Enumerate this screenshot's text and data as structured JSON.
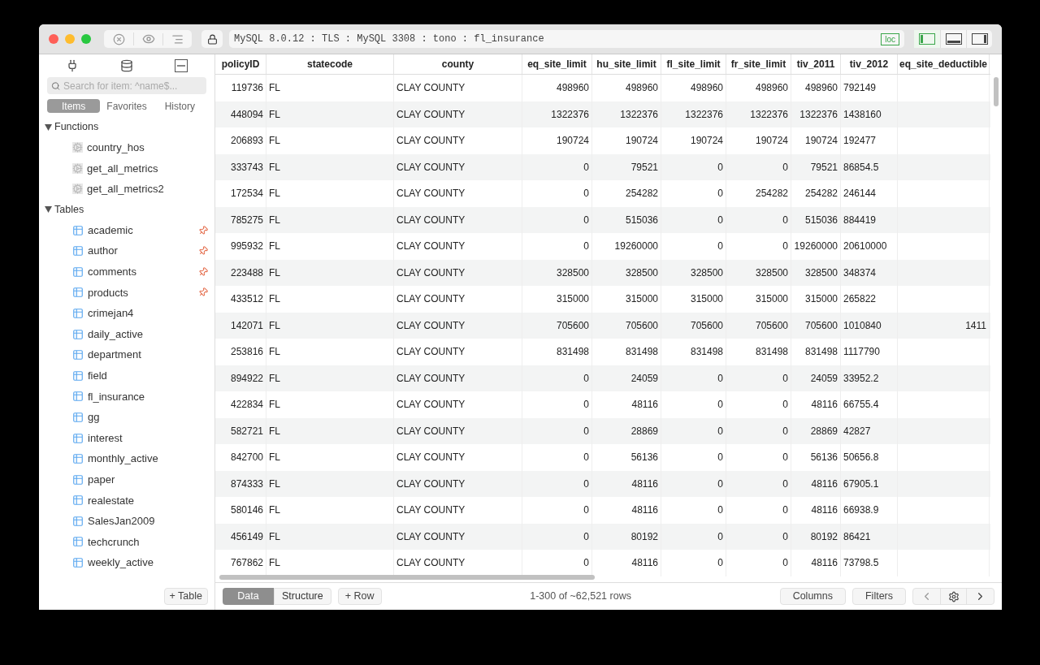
{
  "toolbar": {
    "connection": "MySQL 8.0.12 : TLS : MySQL 3308 : tono : fl_insurance",
    "badge": "loc",
    "layouts": [
      {
        "selected": true
      },
      {
        "selected": false
      },
      {
        "selected": false
      }
    ]
  },
  "sidebar": {
    "search": {
      "placeholder": "Search for item: ^name$..."
    },
    "tabs": [
      {
        "label": "Items",
        "selected": true
      },
      {
        "label": "Favorites",
        "selected": false
      },
      {
        "label": "History",
        "selected": false
      }
    ],
    "groups": [
      {
        "label": "Functions",
        "expanded": true,
        "kind": "function",
        "children": [
          {
            "label": "country_hos",
            "pinned": false
          },
          {
            "label": "get_all_metrics",
            "pinned": false
          },
          {
            "label": "get_all_metrics2",
            "pinned": false
          }
        ]
      },
      {
        "label": "Tables",
        "expanded": true,
        "kind": "table",
        "children": [
          {
            "label": "academic",
            "pinned": true
          },
          {
            "label": "author",
            "pinned": true
          },
          {
            "label": "comments",
            "pinned": true
          },
          {
            "label": "products",
            "pinned": true
          },
          {
            "label": "crimejan4",
            "pinned": false
          },
          {
            "label": "daily_active",
            "pinned": false
          },
          {
            "label": "department",
            "pinned": false
          },
          {
            "label": "field",
            "pinned": false
          },
          {
            "label": "fl_insurance",
            "pinned": false
          },
          {
            "label": "gg",
            "pinned": false
          },
          {
            "label": "interest",
            "pinned": false
          },
          {
            "label": "monthly_active",
            "pinned": false
          },
          {
            "label": "paper",
            "pinned": false
          },
          {
            "label": "realestate",
            "pinned": false
          },
          {
            "label": "SalesJan2009",
            "pinned": false
          },
          {
            "label": "techcrunch",
            "pinned": false
          },
          {
            "label": "weekly_active",
            "pinned": false
          }
        ]
      }
    ],
    "add_button": "+ Table"
  },
  "table": {
    "columns": [
      "policyID",
      "statecode",
      "county",
      "eq_site_limit",
      "hu_site_limit",
      "fl_site_limit",
      "fr_site_limit",
      "tiv_2011",
      "tiv_2012",
      "eq_site_deductible"
    ],
    "rows": [
      [
        "119736",
        "FL",
        "CLAY COUNTY",
        "498960",
        "498960",
        "498960",
        "498960",
        "498960",
        "792149"
      ],
      [
        "448094",
        "FL",
        "CLAY COUNTY",
        "1322376",
        "1322376",
        "1322376",
        "1322376",
        "1322376",
        "1438160"
      ],
      [
        "206893",
        "FL",
        "CLAY COUNTY",
        "190724",
        "190724",
        "190724",
        "190724",
        "190724",
        "192477"
      ],
      [
        "333743",
        "FL",
        "CLAY COUNTY",
        "0",
        "79521",
        "0",
        "0",
        "79521",
        "86854.5"
      ],
      [
        "172534",
        "FL",
        "CLAY COUNTY",
        "0",
        "254282",
        "0",
        "254282",
        "254282",
        "246144"
      ],
      [
        "785275",
        "FL",
        "CLAY COUNTY",
        "0",
        "515036",
        "0",
        "0",
        "515036",
        "884419"
      ],
      [
        "995932",
        "FL",
        "CLAY COUNTY",
        "0",
        "19260000",
        "0",
        "0",
        "19260000",
        "20610000"
      ],
      [
        "223488",
        "FL",
        "CLAY COUNTY",
        "328500",
        "328500",
        "328500",
        "328500",
        "328500",
        "348374"
      ],
      [
        "433512",
        "FL",
        "CLAY COUNTY",
        "315000",
        "315000",
        "315000",
        "315000",
        "315000",
        "265822"
      ],
      [
        "142071",
        "FL",
        "CLAY COUNTY",
        "705600",
        "705600",
        "705600",
        "705600",
        "705600",
        "1010840",
        "1411"
      ],
      [
        "253816",
        "FL",
        "CLAY COUNTY",
        "831498",
        "831498",
        "831498",
        "831498",
        "831498",
        "1117790"
      ],
      [
        "894922",
        "FL",
        "CLAY COUNTY",
        "0",
        "24059",
        "0",
        "0",
        "24059",
        "33952.2"
      ],
      [
        "422834",
        "FL",
        "CLAY COUNTY",
        "0",
        "48116",
        "0",
        "0",
        "48116",
        "66755.4"
      ],
      [
        "582721",
        "FL",
        "CLAY COUNTY",
        "0",
        "28869",
        "0",
        "0",
        "28869",
        "42827"
      ],
      [
        "842700",
        "FL",
        "CLAY COUNTY",
        "0",
        "56136",
        "0",
        "0",
        "56136",
        "50656.8"
      ],
      [
        "874333",
        "FL",
        "CLAY COUNTY",
        "0",
        "48116",
        "0",
        "0",
        "48116",
        "67905.1"
      ],
      [
        "580146",
        "FL",
        "CLAY COUNTY",
        "0",
        "48116",
        "0",
        "0",
        "48116",
        "66938.9"
      ],
      [
        "456149",
        "FL",
        "CLAY COUNTY",
        "0",
        "80192",
        "0",
        "0",
        "80192",
        "86421"
      ],
      [
        "767862",
        "FL",
        "CLAY COUNTY",
        "0",
        "48116",
        "0",
        "0",
        "48116",
        "73798.5"
      ]
    ]
  },
  "footer": {
    "tabs": [
      {
        "label": "Data",
        "selected": true
      },
      {
        "label": "Structure",
        "selected": false
      }
    ],
    "add_row": "+ Row",
    "status": "1-300 of ~62,521 rows",
    "buttons": [
      "Columns",
      "Filters"
    ]
  }
}
